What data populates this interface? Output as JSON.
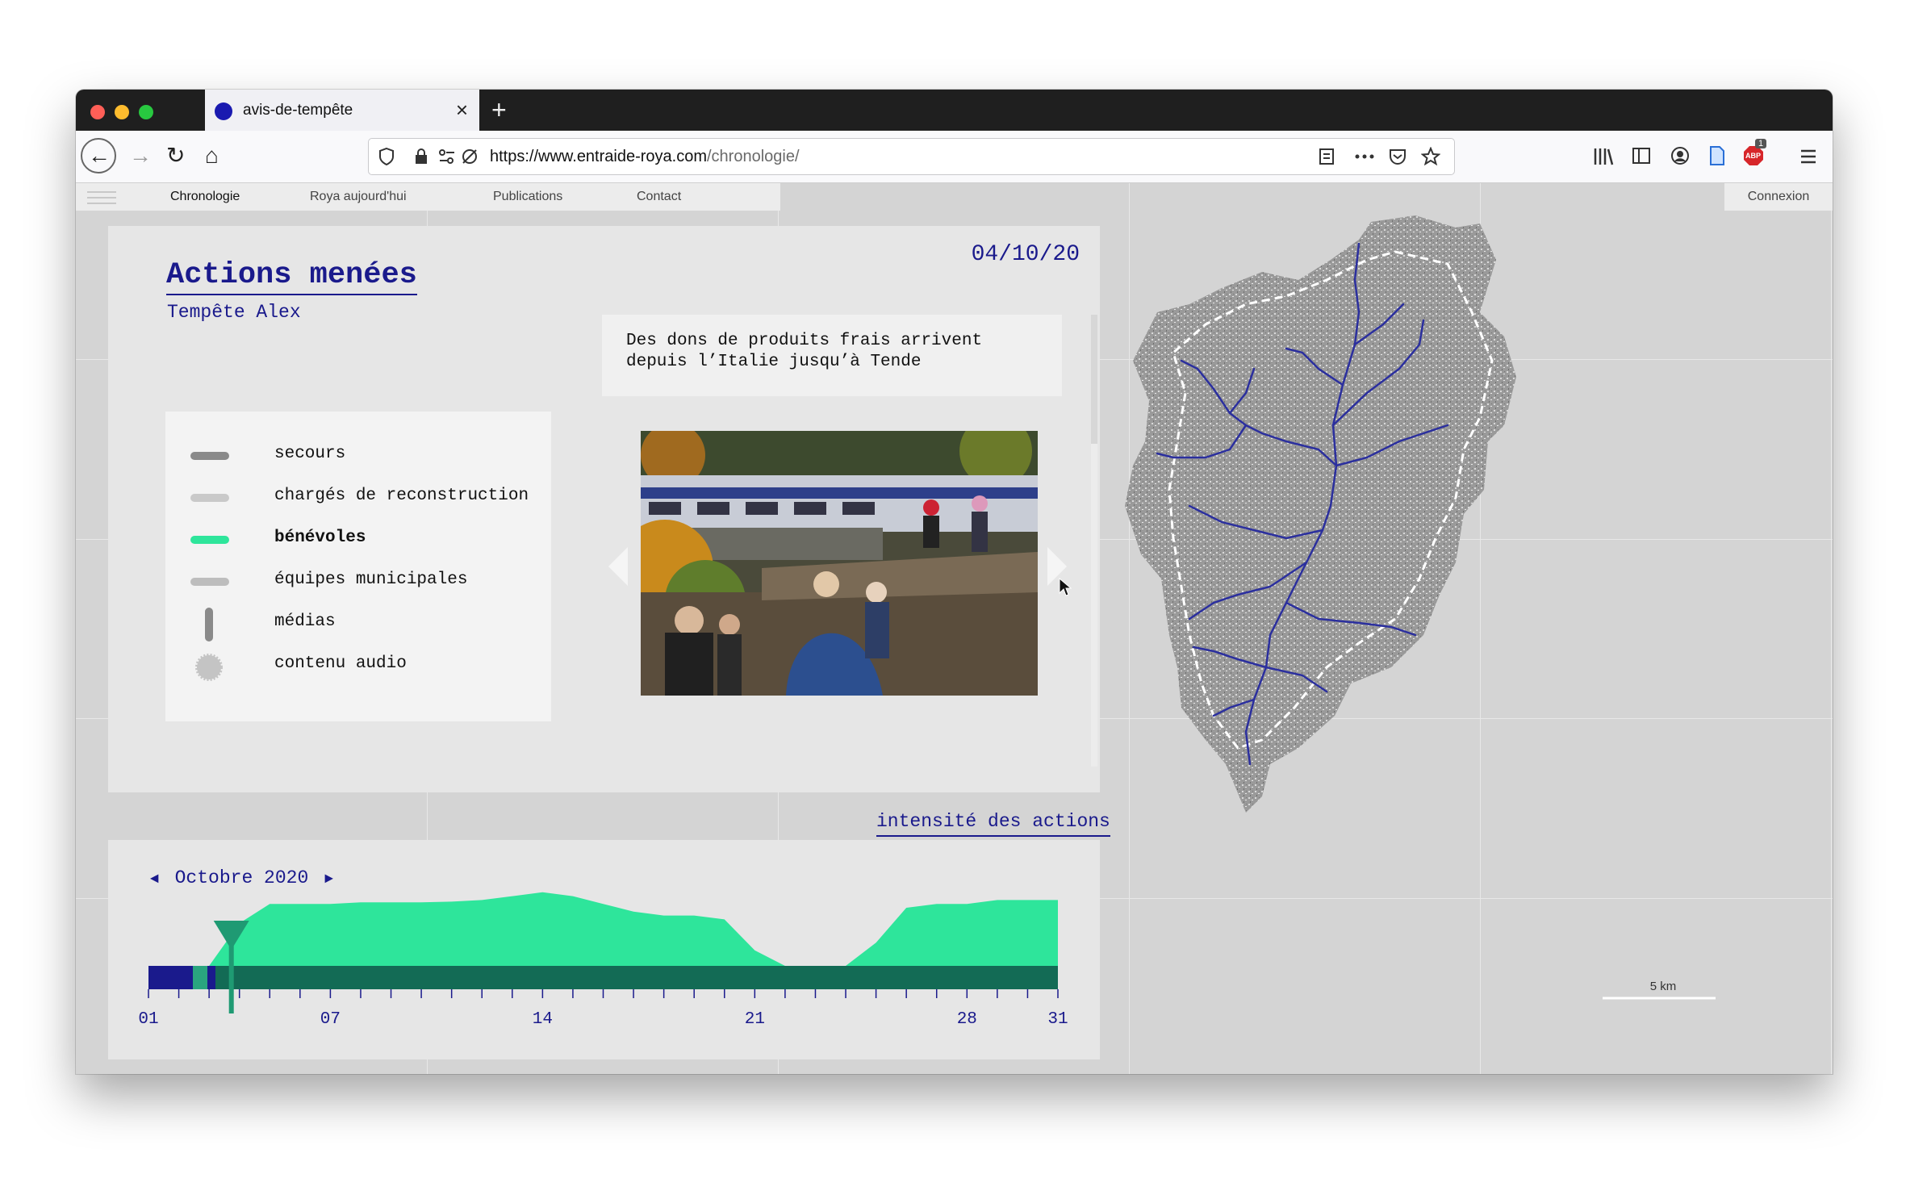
{
  "browser": {
    "tab_title": "avis-de-tempête",
    "new_tab": "+",
    "close_tab": "×",
    "url_host": "https://www.entraide-roya.com",
    "url_path": "/chronologie/",
    "back": "←",
    "forward": "→",
    "reload": "↻",
    "home": "⌂",
    "badge_count": "1",
    "badge_label": "ABP",
    "icons": [
      "shield-icon",
      "lock-icon",
      "permissions-icon",
      "tracking-icon",
      "reader-icon",
      "more-icon",
      "pocket-icon",
      "star-icon",
      "library-icon",
      "sidebar-icon",
      "account-icon",
      "document-icon",
      "adblock-icon",
      "menu-icon"
    ],
    "colors": {
      "tab_dot": "#1a1ab0",
      "close": "#ff5f57",
      "minimize": "#febc2e",
      "maximize": "#28c840"
    }
  },
  "nav": {
    "items": [
      "Chronologie",
      "Roya aujourd'hui",
      "Publications",
      "Contact"
    ],
    "connexion": "Connexion"
  },
  "panel": {
    "title": "Actions menées",
    "subtitle": "Tempête Alex",
    "date": "04/10/20",
    "caption": "Des dons de produits frais arrivent\ndepuis l’Italie jusqu’à Tende",
    "intensity_link": "intensité des actions"
  },
  "legend": [
    {
      "label": "secours",
      "color": "#8a8a8a",
      "shape": "bar",
      "active": false
    },
    {
      "label": "chargés de reconstruction",
      "color": "#c9c9c9",
      "shape": "bar",
      "active": false
    },
    {
      "label": "bénévoles",
      "color": "#2ee59b",
      "shape": "bar",
      "active": true
    },
    {
      "label": "équipes municipales",
      "color": "#bdbdbd",
      "shape": "bar",
      "active": false
    },
    {
      "label": "médias",
      "color": "#8a8a8a",
      "shape": "vbar",
      "active": false
    },
    {
      "label": "contenu audio",
      "color": "#c4c4c4",
      "shape": "burst",
      "active": false
    }
  ],
  "timeline": {
    "prev": "◄",
    "next": "►",
    "month": "Octobre 2020",
    "ticks": [
      "01",
      "07",
      "14",
      "21",
      "28",
      "31"
    ],
    "selected_day": 4,
    "accent": "#2ee59b",
    "dark": "#1a1a8c"
  },
  "map": {
    "scale_label": "5 km",
    "river_color": "#2b2f9e"
  },
  "chart_data": {
    "type": "area",
    "title": "",
    "xlabel": "",
    "ylabel": "",
    "x": [
      1,
      2,
      3,
      4,
      5,
      6,
      7,
      8,
      9,
      10,
      11,
      12,
      13,
      14,
      15,
      16,
      17,
      18,
      19,
      20,
      21,
      22,
      23,
      24,
      25,
      26,
      27,
      28,
      29,
      30,
      31
    ],
    "series": [
      {
        "values": [
          0,
          0,
          0,
          0.55,
          0.8,
          0.8,
          0.8,
          0.82,
          0.82,
          0.82,
          0.83,
          0.85,
          0.9,
          0.95,
          0.9,
          0.8,
          0.7,
          0.65,
          0.65,
          0.6,
          0.2,
          0,
          0,
          0,
          0.3,
          0.75,
          0.8,
          0.8,
          0.85,
          0.85,
          0.85
        ]
      }
    ],
    "ylim": [
      0,
      1
    ],
    "grid": false
  }
}
